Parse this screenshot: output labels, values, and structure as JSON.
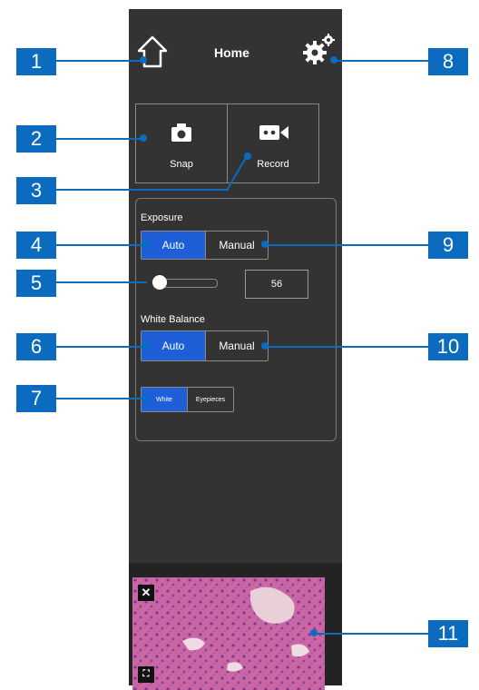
{
  "header": {
    "title": "Home",
    "home_icon": "home-icon",
    "settings_icon": "gear-icon"
  },
  "capture": {
    "snap_label": "Snap",
    "record_label": "Record"
  },
  "exposure": {
    "label": "Exposure",
    "auto": "Auto",
    "manual": "Manual",
    "value": "56",
    "selected": "Auto"
  },
  "white_balance": {
    "label": "White Balance",
    "auto": "Auto",
    "manual": "Manual",
    "selected": "Auto",
    "white": "White",
    "eyepieces": "Eyepieces",
    "preset_selected": "White"
  },
  "callouts": [
    "1",
    "2",
    "3",
    "4",
    "5",
    "6",
    "7",
    "8",
    "9",
    "10",
    "11"
  ],
  "colors": {
    "accent": "#1e5fd8",
    "callout": "#0a6bbf",
    "panel": "#333333"
  }
}
